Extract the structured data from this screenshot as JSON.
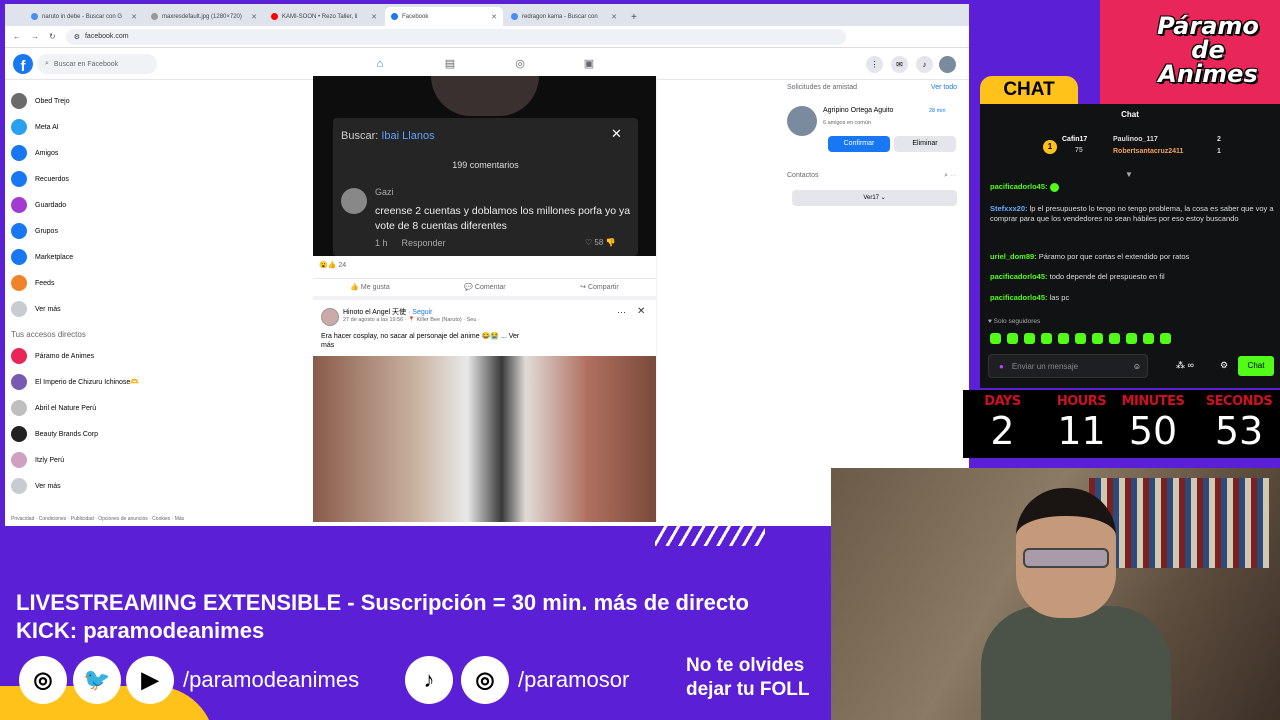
{
  "browser": {
    "tabs": [
      {
        "label": "naruto in debe - Buscar con G",
        "color": "#4c8bf5"
      },
      {
        "label": "maxresdefault.jpg (1280×720)",
        "color": "#999999"
      },
      {
        "label": "KAMI-SOON • Rezo Taller, li",
        "color": "#ff0000"
      },
      {
        "label": "Facebook",
        "color": "#1877f2"
      },
      {
        "label": "redragon kama - Buscar con",
        "color": "#4c8bf5"
      }
    ],
    "url": "facebook.com"
  },
  "fb": {
    "search_placeholder": "Buscar en Facebook",
    "logo": "f",
    "sidebar": [
      {
        "label": "Obed Trejo",
        "color": "#6b6b6b"
      },
      {
        "label": "Meta AI",
        "color": "#2aa0f0"
      },
      {
        "label": "Amigos",
        "color": "#1877f2"
      },
      {
        "label": "Recuerdos",
        "color": "#1877f2"
      },
      {
        "label": "Guardado",
        "color": "#a33bd1"
      },
      {
        "label": "Grupos",
        "color": "#1877f2"
      },
      {
        "label": "Marketplace",
        "color": "#1877f2"
      },
      {
        "label": "Feeds",
        "color": "#f0832a"
      },
      {
        "label": "Ver más",
        "color": "#c8ccd2"
      }
    ],
    "shortcuts_title": "Tus accesos directos",
    "shortcuts": [
      {
        "label": "Páramo de Animes",
        "color": "#e8265a"
      },
      {
        "label": "El Imperio de Chizuru Ichinose🫶",
        "color": "#7a5ab0"
      },
      {
        "label": "Abril el Nature Perú",
        "color": "#bfbfbf"
      },
      {
        "label": "Beauty Brands Corp",
        "color": "#222222"
      },
      {
        "label": "Itzly Perú",
        "color": "#d0a0c0"
      },
      {
        "label": "Ver más",
        "color": "#c8ccd2"
      }
    ],
    "footer": "Privacidad · Condiciones · Publicidad · Opciones de anuncios · Cookies · Más",
    "video_overlay": {
      "search_prefix": "Buscar:",
      "search_term": "Ibai Llanos",
      "comments": "199 comentarios",
      "commenter": "Gazi",
      "comment": "creense 2 cuentas y doblamos los millones porfa yo ya vote de 8 cuentas diferentes",
      "time": "1 h",
      "reply": "Responder",
      "likes": "58"
    },
    "reactions": "24",
    "actions": [
      "Me gusta",
      "Comentar",
      "Compartir"
    ],
    "post": {
      "author": "Hinoto el Angel 天使",
      "follow": "· Seguir",
      "date": "27 de agosto a las 19:56 · 📍 Killer Bee (Naruto) · Seu ·",
      "text": "Era hacer cosplay, no sacar al personaje del anime 😂😭 ... Ver más"
    },
    "friend_requests": {
      "title": "Solicitudes de amistad",
      "see_all": "Ver todo",
      "name": "Agripino Ortega Aguito",
      "mutual": "6 amigos en común",
      "time": "28 min",
      "confirm": "Confirmar",
      "delete": "Eliminar"
    },
    "contacts_title": "Contactos",
    "contacts_button": "Ver17 ⌄"
  },
  "stream": {
    "brand": "Páramo de Animes",
    "chat_label": "CHAT",
    "chat_title": "Chat",
    "leaders": [
      {
        "name": "Cafin17",
        "pts": "75"
      },
      {
        "name": "Paulinoo_117",
        "pts": "2"
      },
      {
        "name": "Robertsantacruz2411",
        "pts": "1"
      }
    ],
    "messages": [
      {
        "user": "pacificadorlo45:",
        "text": ""
      },
      {
        "user": "Stefxxx20:",
        "text": "lp el presupuesto lo tengo no tengo problema, la cosa es saber que voy a comprar para que los vendedores no sean hábiles por eso estoy buscando"
      },
      {
        "user": "uriel_dom89:",
        "text": "Páramo por que cortas el extendido por ratos"
      },
      {
        "user": "pacificadorlo45:",
        "text": "todo depende del prespuesto en fil"
      },
      {
        "user": "pacificadorlo45:",
        "text": "las pc"
      }
    ],
    "subs_only": "♥ Solo seguidores",
    "send_placeholder": "Enviar un mensaje",
    "points": "∞",
    "send_button": "Chat",
    "countdown": {
      "days_label": "DAYS",
      "days": "2",
      "hours_label": "HOURS",
      "hours": "11",
      "minutes_label": "MINUTES",
      "minutes": "50",
      "seconds_label": "SECONDS",
      "seconds": "53"
    },
    "banner": {
      "line1": "LIVESTREAMING EXTENSIBLE - Suscripción = 30 min. más de directo",
      "line2": "KICK: paramodeanimes",
      "handle1": "/paramodeanimes",
      "handle2": "/paramosor",
      "reminder1": "No te olvides",
      "reminder2": "dejar tu FOLL"
    }
  }
}
